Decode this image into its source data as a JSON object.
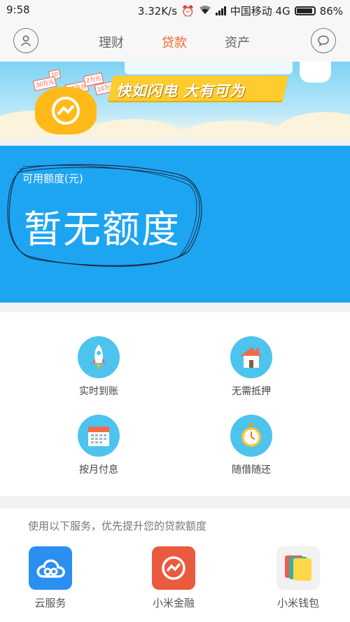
{
  "status_bar": {
    "time": "9:58",
    "speed": "3.32K/s",
    "carrier": "中国移动 4G",
    "battery": "86%"
  },
  "nav": {
    "tabs": [
      {
        "label": "理财",
        "active": false
      },
      {
        "label": "贷款",
        "active": true
      },
      {
        "label": "资产",
        "active": false
      }
    ],
    "accent": "#ef6a2e"
  },
  "banner": {
    "slogan": "快如闪电  大有可为",
    "tags": [
      "10",
      "30万元",
      "10万元",
      "2万元",
      "10万元"
    ]
  },
  "credit": {
    "label": "可用额度(元)",
    "value": "暂无额度",
    "color": "#1ea5f2"
  },
  "features": [
    {
      "label": "实时到账",
      "icon": "rocket-icon"
    },
    {
      "label": "无需抵押",
      "icon": "house-icon"
    },
    {
      "label": "按月付息",
      "icon": "calendar-icon"
    },
    {
      "label": "随借随还",
      "icon": "stopwatch-icon"
    }
  ],
  "services": {
    "title": "使用以下服务，优先提升您的贷款额度",
    "items": [
      {
        "label": "云服务",
        "icon": "cloud-service-icon",
        "color": "#2b8ff0"
      },
      {
        "label": "小米金融",
        "icon": "mi-finance-icon",
        "color": "#ea5a3e"
      },
      {
        "label": "小米钱包",
        "icon": "wallet-icon",
        "color": "#f1f1f1"
      }
    ]
  }
}
